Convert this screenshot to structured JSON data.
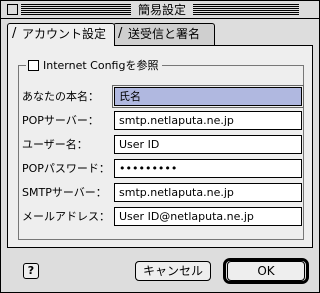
{
  "window": {
    "title": "簡易設定"
  },
  "tabs": [
    {
      "label": "アカウント設定",
      "active": true
    },
    {
      "label": "送受信と署名",
      "active": false
    }
  ],
  "group": {
    "checkbox_label": "Internet Configを参照",
    "checked": false
  },
  "fields": [
    {
      "label": "あなたの本名：",
      "value": "氏名",
      "focused": true
    },
    {
      "label": "POPサーバー：",
      "value": "smtp.netlaputa.ne.jp"
    },
    {
      "label": "ユーザー名：",
      "value": "User ID"
    },
    {
      "label": "POPパスワード：",
      "value": "•••••••••"
    },
    {
      "label": "SMTPサーバー：",
      "value": "smtp.netlaputa.ne.jp"
    },
    {
      "label": "メールアドレス：",
      "value": "User ID@netlaputa.ne.jp"
    }
  ],
  "buttons": {
    "help": "?",
    "cancel": "キャンセル",
    "ok": "OK"
  }
}
